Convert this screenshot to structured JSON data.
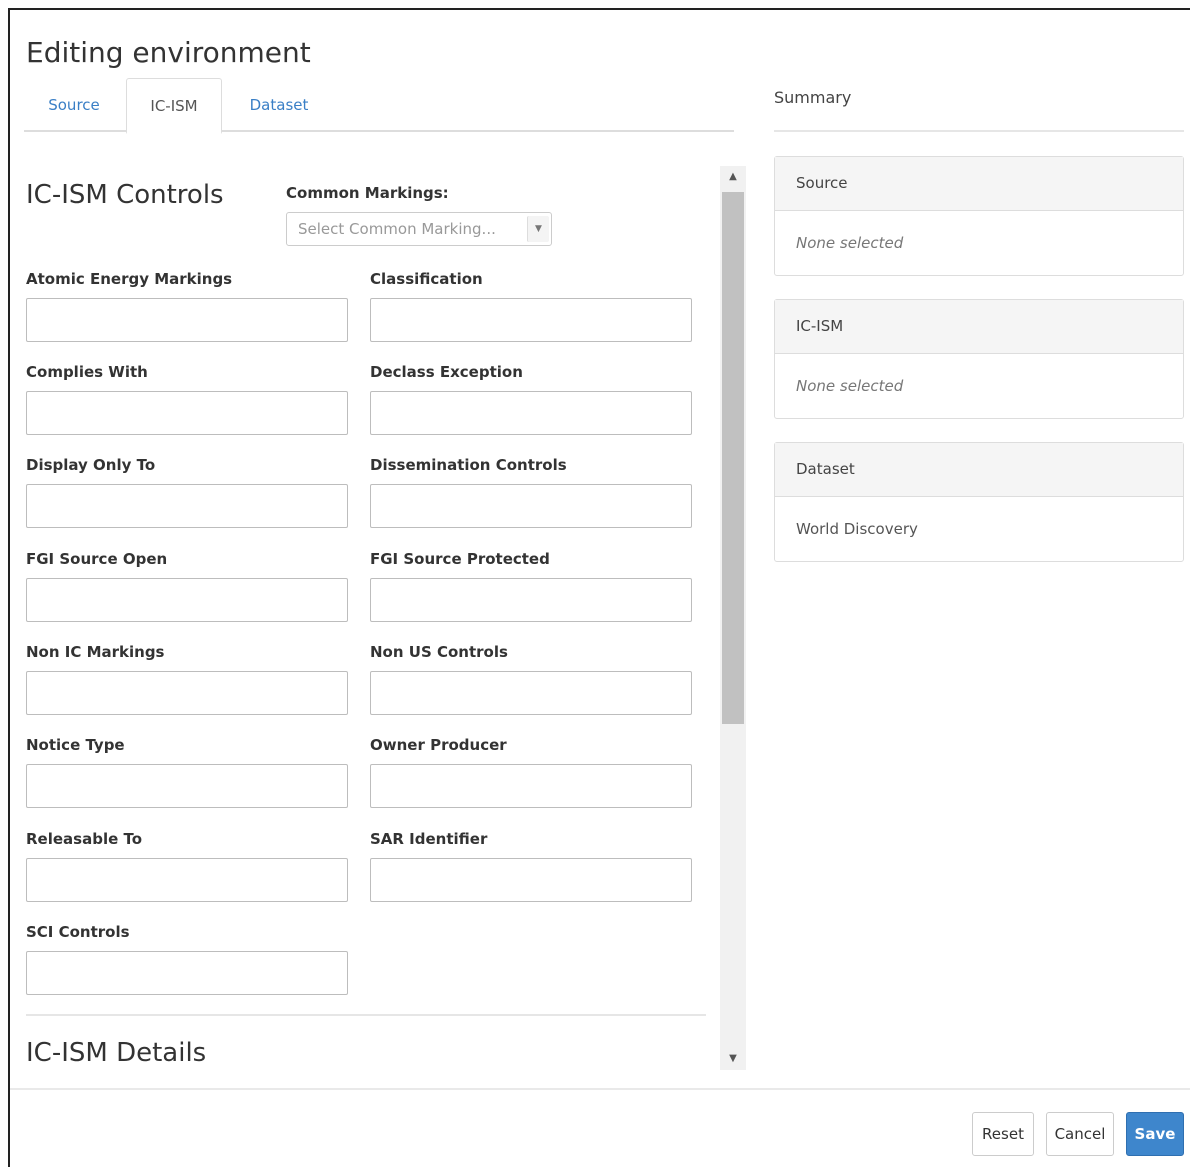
{
  "dialog": {
    "title": "Editing environment"
  },
  "tabs": [
    {
      "label": "Source",
      "active": false
    },
    {
      "label": "IC-ISM",
      "active": true
    },
    {
      "label": "Dataset",
      "active": false
    }
  ],
  "summary": {
    "title": "Summary",
    "cards": [
      {
        "header": "Source",
        "value": "None selected"
      },
      {
        "header": "IC-ISM",
        "value": "None selected"
      },
      {
        "header": "Dataset",
        "value": "World Discovery"
      }
    ]
  },
  "controls": {
    "heading": "IC-ISM Controls",
    "common_markings_label": "Common Markings:",
    "common_markings_placeholder": "Select Common Marking...",
    "fields": [
      {
        "label": "Atomic Energy Markings",
        "value": ""
      },
      {
        "label": "Classification",
        "value": ""
      },
      {
        "label": "Complies With",
        "value": ""
      },
      {
        "label": "Declass Exception",
        "value": ""
      },
      {
        "label": "Display Only To",
        "value": ""
      },
      {
        "label": "Dissemination Controls",
        "value": ""
      },
      {
        "label": "FGI Source Open",
        "value": ""
      },
      {
        "label": "FGI Source Protected",
        "value": ""
      },
      {
        "label": "Non IC Markings",
        "value": ""
      },
      {
        "label": "Non US Controls",
        "value": ""
      },
      {
        "label": "Notice Type",
        "value": ""
      },
      {
        "label": "Owner Producer",
        "value": ""
      },
      {
        "label": "Releasable To",
        "value": ""
      },
      {
        "label": "SAR Identifier",
        "value": ""
      },
      {
        "label": "SCI Controls",
        "value": ""
      }
    ]
  },
  "details": {
    "heading": "IC-ISM Details"
  },
  "footer": {
    "reset_label": "Reset",
    "cancel_label": "Cancel",
    "save_label": "Save"
  },
  "colors": {
    "link": "#3a7fc6",
    "primary": "#3e86cc"
  }
}
